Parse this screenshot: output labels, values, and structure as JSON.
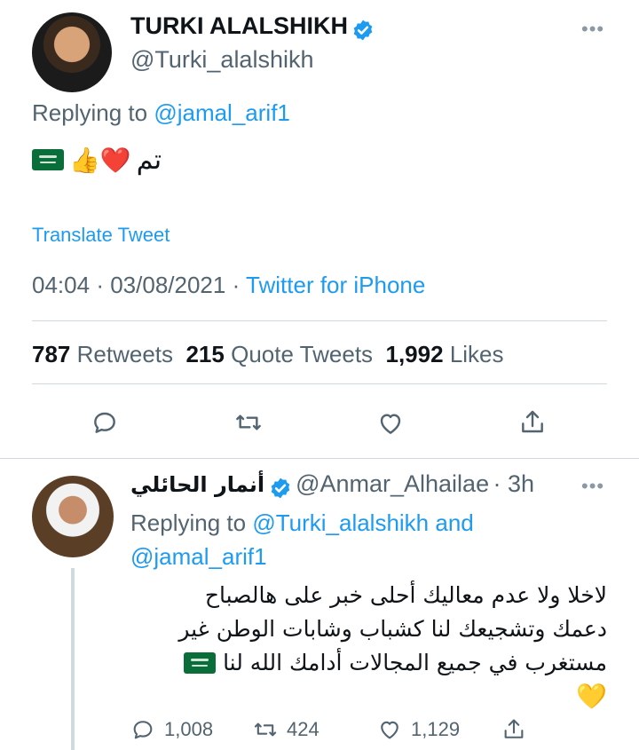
{
  "main_tweet": {
    "author_name": "TURKI ALALSHIKH",
    "author_handle": "@Turki_alalshikh",
    "more": "•••",
    "replying_prefix": "Replying to",
    "replying_to": "@jamal_arif1",
    "text_emoji": "👍❤️",
    "text_arabic": "تم",
    "translate": "Translate Tweet",
    "time": "04:04",
    "date": "03/08/2021",
    "dot": "·",
    "source": "Twitter for iPhone",
    "stats": {
      "retweets_count": "787",
      "retweets_label": "Retweets",
      "quotes_count": "215",
      "quotes_label": "Quote Tweets",
      "likes_count": "1,992",
      "likes_label": "Likes"
    }
  },
  "reply_tweet": {
    "author_name": "أنمار الحائلي",
    "author_handle": "@Anmar_Alhailae",
    "time_ago": "· 3h",
    "more": "•••",
    "replying_prefix": "Replying to",
    "replying_to_1": "@Turki_alalshikh",
    "replying_and": "and",
    "replying_to_2": "@jamal_arif1",
    "text_line1": "لاخلا ولا عدم معاليك أحلى خبر على هالصباح",
    "text_line2": "دعمك وتشجيعك لنا كشباب وشابات الوطن غير",
    "text_line3": "مستغرب في جميع المجالات أدامك الله لنا",
    "text_heart": "💛",
    "counts": {
      "replies": "1,008",
      "retweets": "424",
      "likes": "1,129"
    }
  },
  "colors": {
    "accent": "#1d9bf0",
    "muted": "#536471",
    "separator": "#cfd9de",
    "flag": "#0a6e3a"
  }
}
